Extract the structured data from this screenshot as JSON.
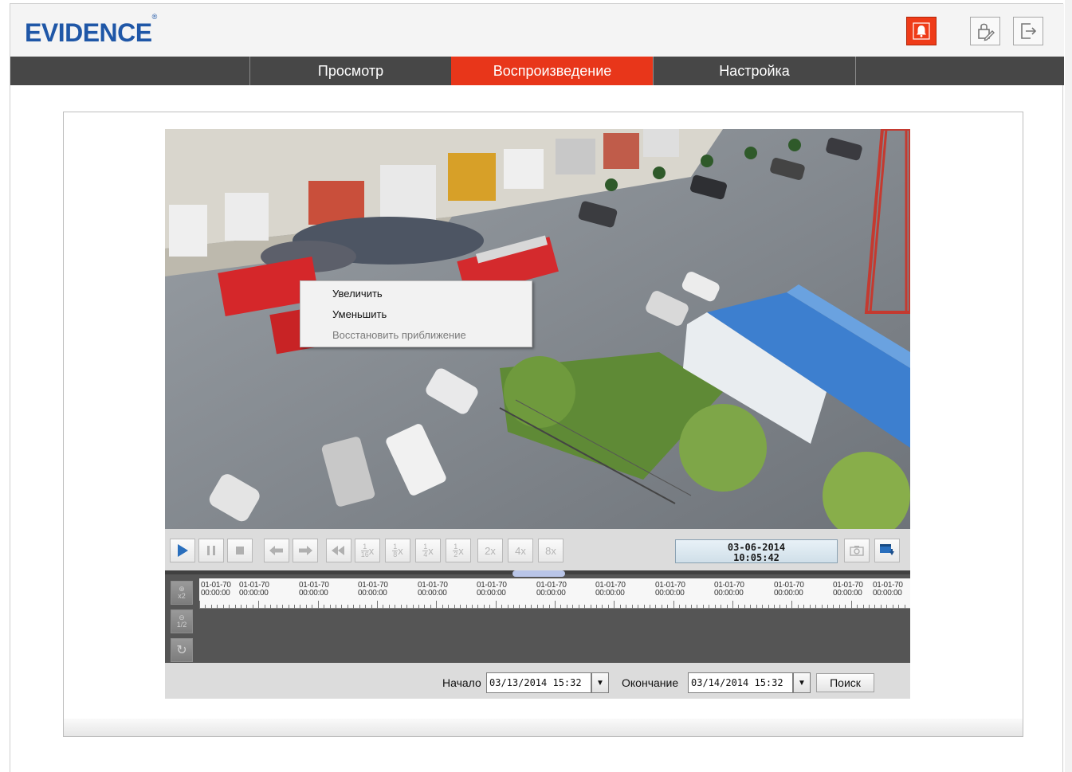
{
  "header": {
    "logo": "EVIDENCE",
    "logo_mark": "®",
    "icons": [
      "alarm-bell-icon",
      "lock-edit-icon",
      "logout-icon"
    ],
    "alarm_color": "#ef3b18",
    "brand_color": "#1f57a7"
  },
  "nav": {
    "tabs": [
      {
        "label": "Просмотр",
        "active": false
      },
      {
        "label": "Воспроизведение",
        "active": true
      },
      {
        "label": "Настройка",
        "active": false
      }
    ],
    "active_color": "#e8361a"
  },
  "context_menu": {
    "items": [
      {
        "label": "Увеличить",
        "enabled": true
      },
      {
        "label": "Уменьшить",
        "enabled": true
      },
      {
        "label": "Восстановить приближение",
        "enabled": false
      }
    ]
  },
  "controls": {
    "buttons": [
      "play-icon",
      "pause-icon",
      "stop-icon",
      "step-back-icon",
      "step-forward-icon",
      "rewind-icon"
    ],
    "speeds": [
      {
        "num": "1",
        "den": "16",
        "suffix": "x"
      },
      {
        "num": "1",
        "den": "8",
        "suffix": "x"
      },
      {
        "num": "1",
        "den": "4",
        "suffix": "x"
      },
      {
        "num": "1",
        "den": "2",
        "suffix": "x"
      }
    ],
    "fast_speeds": [
      "2x",
      "4x",
      "8x"
    ],
    "date": "03-06-2014",
    "time": "10:05:42",
    "right_buttons": [
      "camera-snapshot-icon",
      "download-icon"
    ]
  },
  "timeline": {
    "labels": [
      {
        "date": "01-01-70",
        "time": "00:00:00"
      },
      {
        "date": "01-01-70",
        "time": "00:00:00"
      },
      {
        "date": "01-01-70",
        "time": "00:00:00"
      },
      {
        "date": "01-01-70",
        "time": "00:00:00"
      },
      {
        "date": "01-01-70",
        "time": "00:00:00"
      },
      {
        "date": "01-01-70",
        "time": "00:00:00"
      },
      {
        "date": "01-01-70",
        "time": "00:00:00"
      },
      {
        "date": "01-01-70",
        "time": "00:00:00"
      },
      {
        "date": "01-01-70",
        "time": "00:00:00"
      },
      {
        "date": "01-01-70",
        "time": "00:00:00"
      },
      {
        "date": "01-01-70",
        "time": "00:00:00"
      },
      {
        "date": "01-01-70",
        "time": "00:00:00"
      },
      {
        "date": "01-01-70",
        "time": "00:00:00"
      },
      {
        "date": "01-01-70",
        "time": "00:00:00"
      }
    ],
    "zoom_in_label": "x2",
    "zoom_out_label": "1/2"
  },
  "search": {
    "start_label": "Начало",
    "start_value": "03/13/2014  15:32",
    "end_label": "Окончание",
    "end_value": "03/14/2014  15:32",
    "button_label": "Поиск"
  }
}
